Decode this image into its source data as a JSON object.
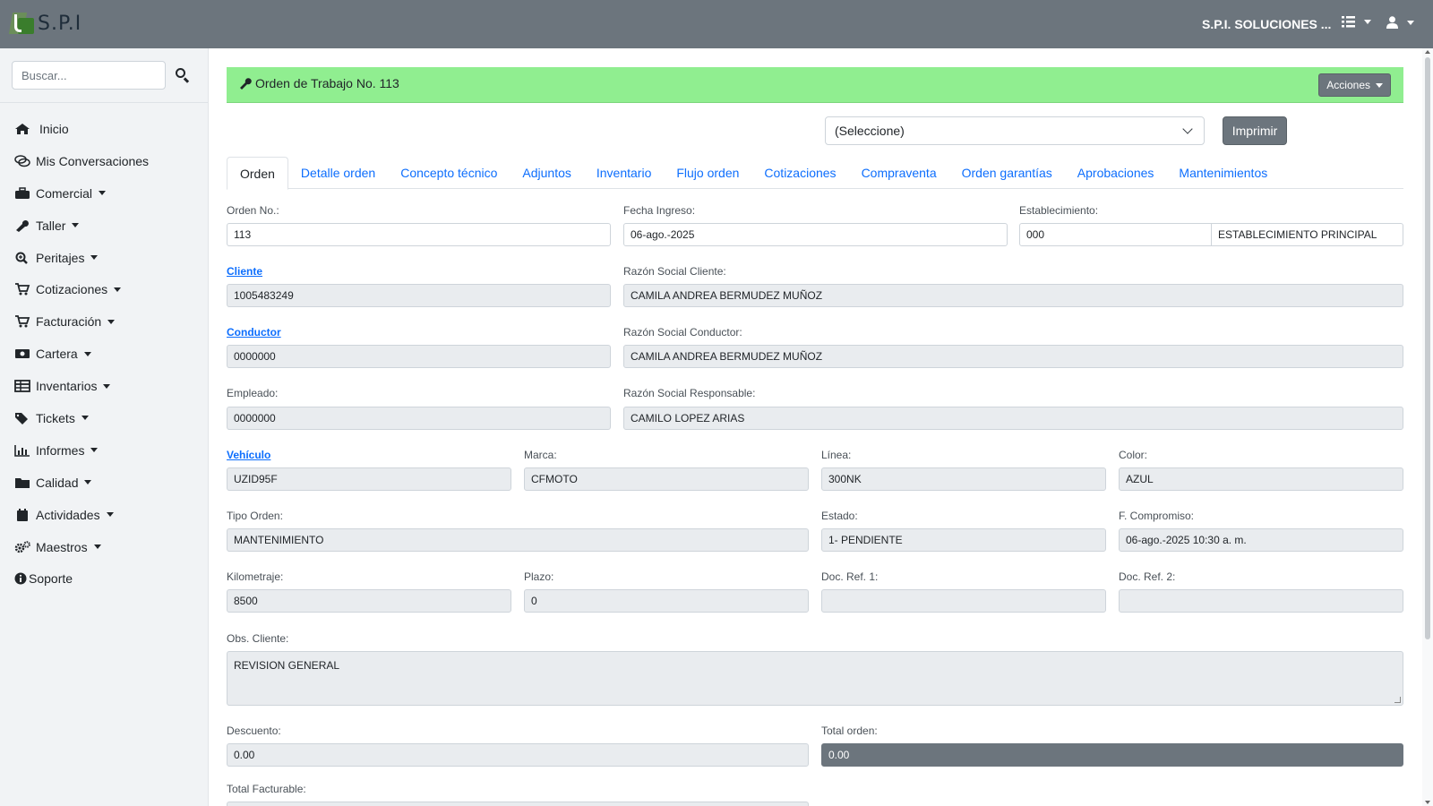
{
  "topbar": {
    "brand": "S.P.I",
    "company": "S.P.I. SOLUCIONES ..."
  },
  "sidebar": {
    "search_placeholder": "Buscar...",
    "items": [
      {
        "label": "Inicio",
        "icon": "home-icon"
      },
      {
        "label": "Mis Conversaciones",
        "icon": "chat-icon"
      },
      {
        "label": "Comercial",
        "icon": "briefcase-icon",
        "dropdown": true
      },
      {
        "label": "Taller",
        "icon": "wrench-icon",
        "dropdown": true
      },
      {
        "label": "Peritajes",
        "icon": "magnifier-plus-icon",
        "dropdown": true
      },
      {
        "label": "Cotizaciones",
        "icon": "cart-icon",
        "dropdown": true
      },
      {
        "label": "Facturación",
        "icon": "cart-icon",
        "dropdown": true
      },
      {
        "label": "Cartera",
        "icon": "money-icon",
        "dropdown": true
      },
      {
        "label": "Inventarios",
        "icon": "table-icon",
        "dropdown": true
      },
      {
        "label": "Tickets",
        "icon": "tags-icon",
        "dropdown": true
      },
      {
        "label": "Informes",
        "icon": "chart-icon",
        "dropdown": true
      },
      {
        "label": "Calidad",
        "icon": "folder-icon",
        "dropdown": true
      },
      {
        "label": "Actividades",
        "icon": "calendar-icon",
        "dropdown": true
      },
      {
        "label": "Maestros",
        "icon": "cogs-icon",
        "dropdown": true
      },
      {
        "label": "Soporte",
        "icon": "info-icon"
      }
    ]
  },
  "header": {
    "title": "Orden de Trabajo No. 113",
    "actions_label": "Acciones",
    "bg_color": "#90ee90"
  },
  "toolbar": {
    "select_value": "(Seleccione)",
    "print_label": "Imprimir"
  },
  "tabs": [
    "Orden",
    "Detalle orden",
    "Concepto técnico",
    "Adjuntos",
    "Inventario",
    "Flujo orden",
    "Cotizaciones",
    "Compraventa",
    "Orden garantías",
    "Aprobaciones",
    "Mantenimientos"
  ],
  "form": {
    "orden_no": {
      "label": "Orden No.:",
      "value": "113"
    },
    "fecha_ingreso": {
      "label": "Fecha Ingreso:",
      "value": "06-ago.-2025"
    },
    "establecimiento": {
      "label": "Establecimiento:",
      "code": "000",
      "name": "ESTABLECIMIENTO PRINCIPAL"
    },
    "cliente": {
      "label": "Cliente",
      "value": "1005483249"
    },
    "razon_cliente": {
      "label": "Razón Social Cliente:",
      "value": "CAMILA ANDREA BERMUDEZ MUÑOZ"
    },
    "conductor": {
      "label": "Conductor",
      "value": "0000000"
    },
    "razon_conductor": {
      "label": "Razón Social Conductor:",
      "value": "CAMILA ANDREA BERMUDEZ MUÑOZ"
    },
    "empleado": {
      "label": "Empleado:",
      "value": "0000000"
    },
    "razon_responsable": {
      "label": "Razón Social Responsable:",
      "value": "CAMILO LOPEZ ARIAS"
    },
    "vehiculo": {
      "label": "Vehículo",
      "value": "UZID95F"
    },
    "marca": {
      "label": "Marca:",
      "value": "CFMOTO"
    },
    "linea": {
      "label": "Línea:",
      "value": "300NK"
    },
    "color": {
      "label": "Color:",
      "value": "AZUL"
    },
    "tipo_orden": {
      "label": "Tipo Orden:",
      "value": "MANTENIMIENTO"
    },
    "estado": {
      "label": "Estado:",
      "value": "1- PENDIENTE"
    },
    "compromiso": {
      "label": "F. Compromiso:",
      "value": "06-ago.-2025 10:30 a. m."
    },
    "kilometraje": {
      "label": "Kilometraje:",
      "value": "8500"
    },
    "plazo": {
      "label": "Plazo:",
      "value": "0"
    },
    "doc_ref1": {
      "label": "Doc. Ref. 1:",
      "value": ""
    },
    "doc_ref2": {
      "label": "Doc. Ref. 2:",
      "value": ""
    },
    "obs_cliente": {
      "label": "Obs. Cliente:",
      "value": "REVISION GENERAL"
    },
    "descuento": {
      "label": "Descuento:",
      "value": "0.00"
    },
    "total_orden": {
      "label": "Total orden:",
      "value": "0.00"
    },
    "total_facturable": {
      "label": "Total Facturable:"
    }
  }
}
